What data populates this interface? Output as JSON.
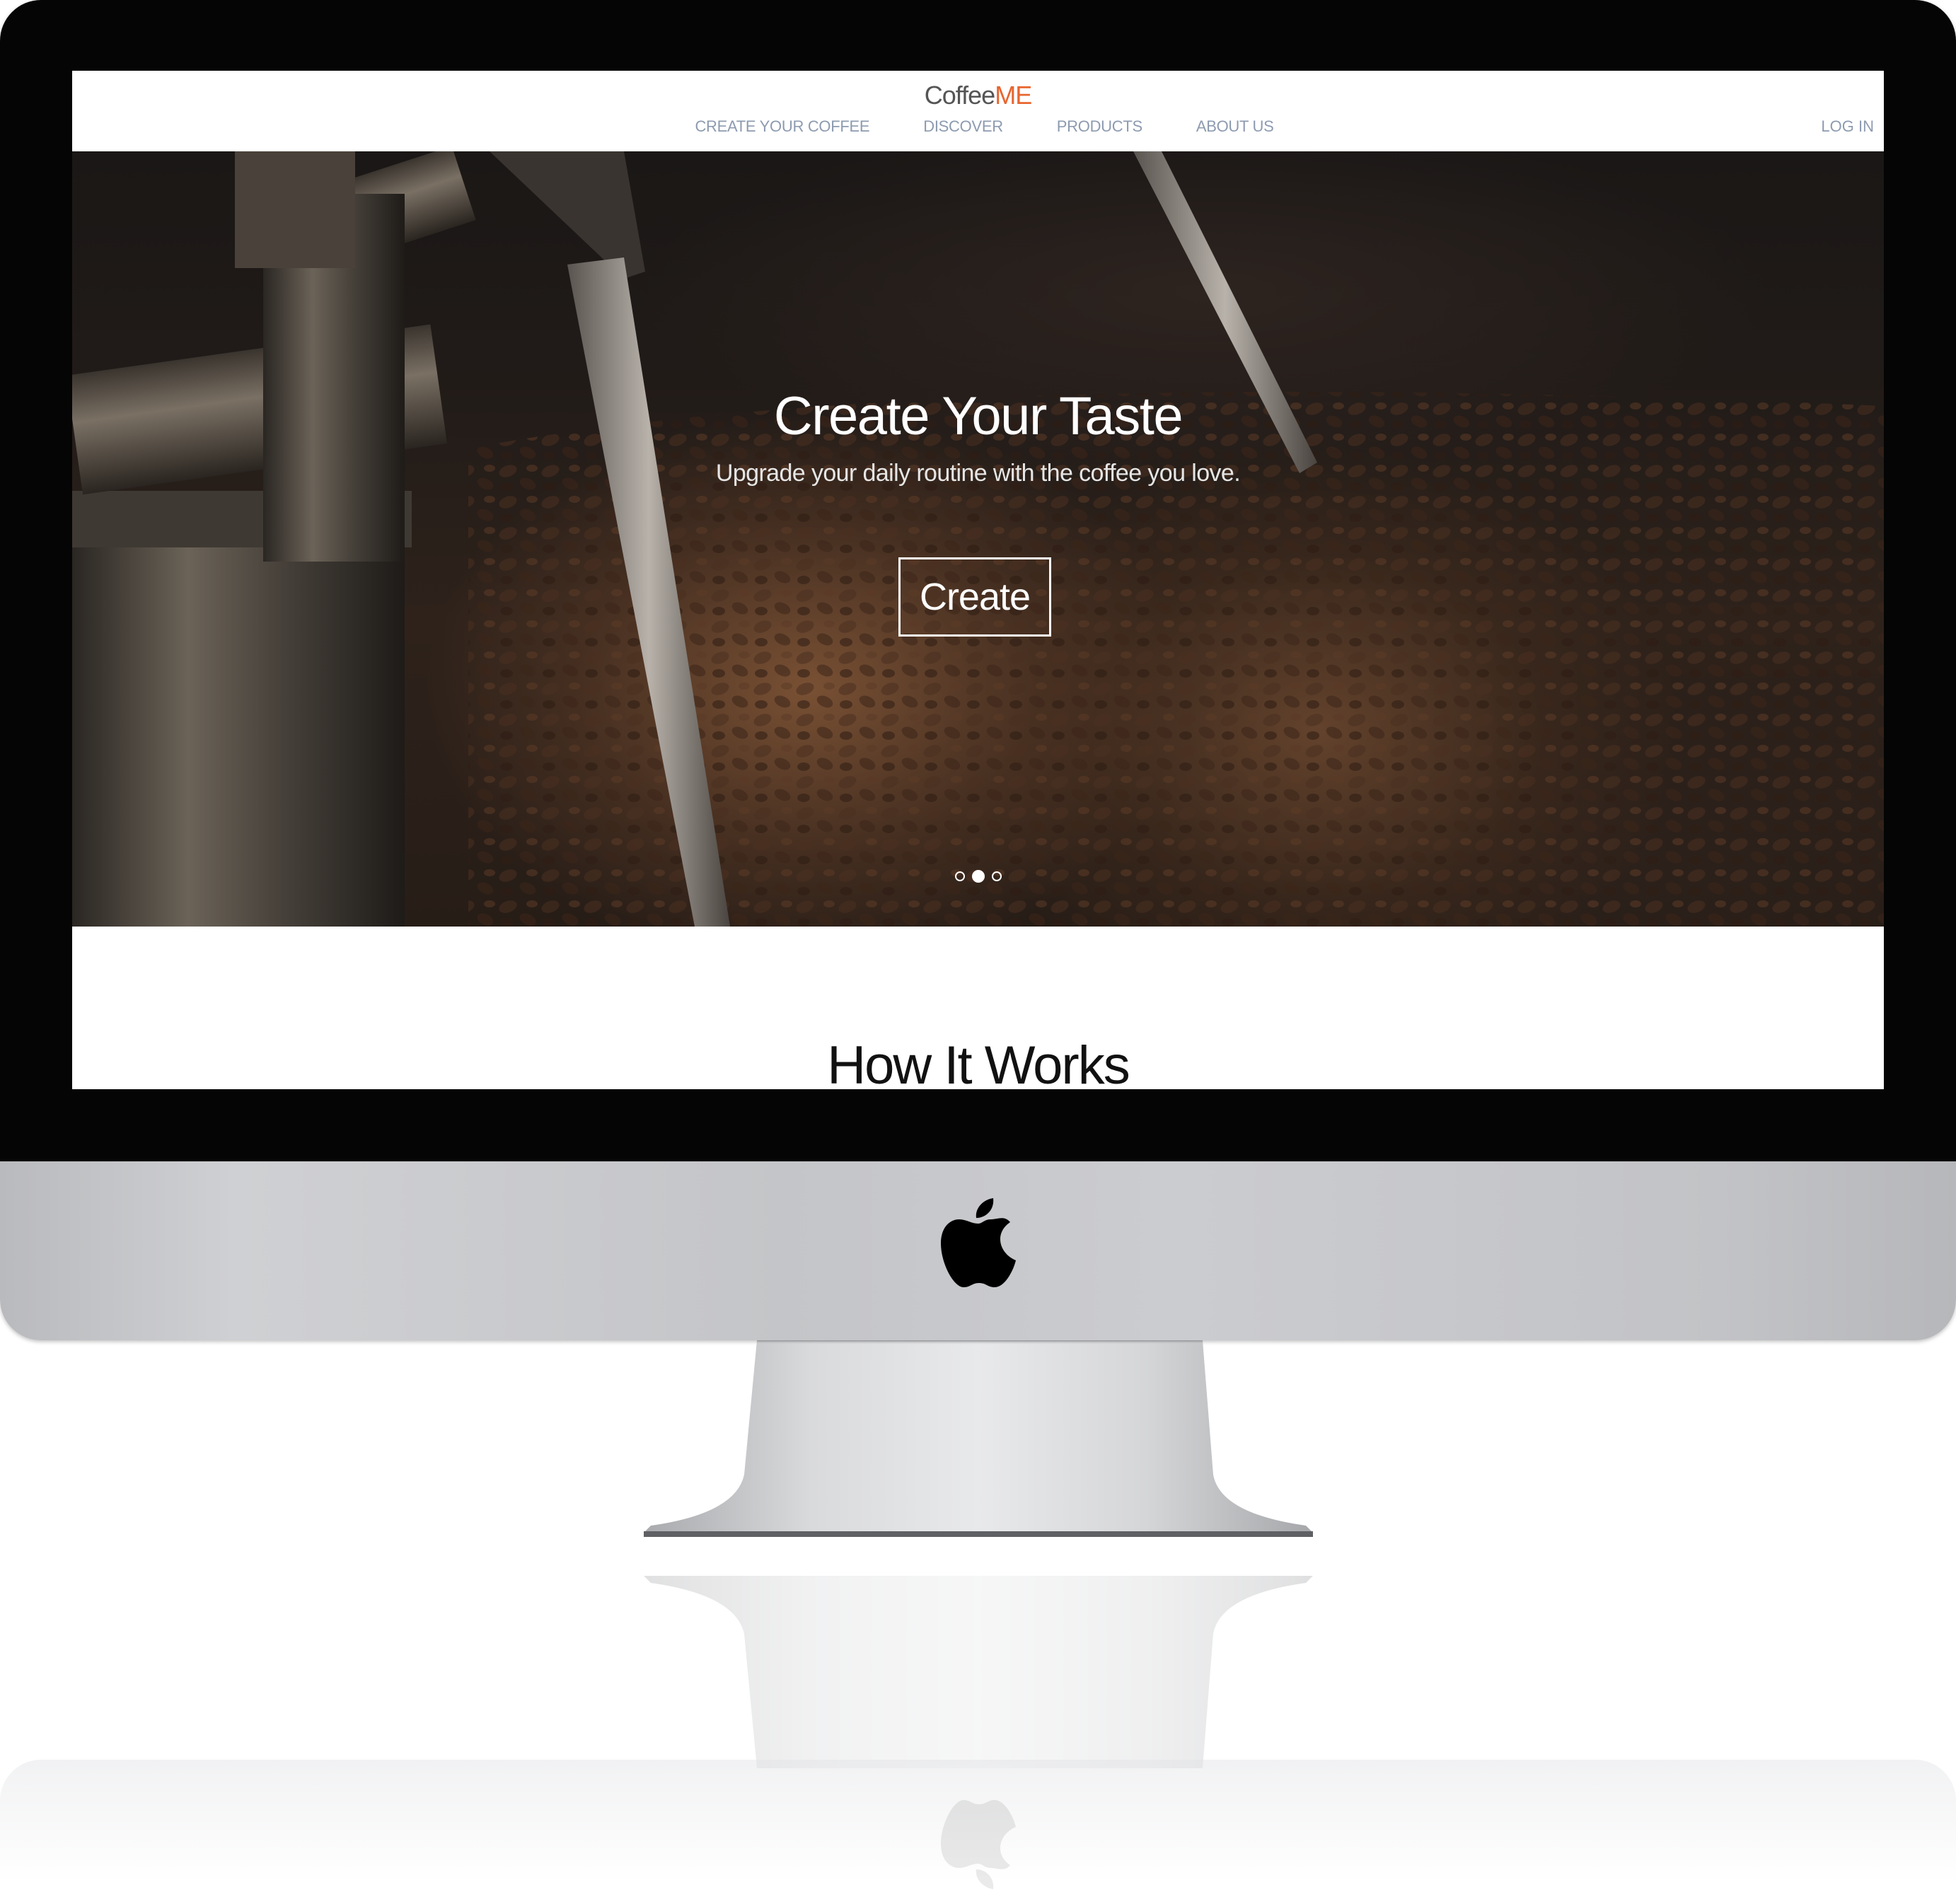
{
  "brand": {
    "name_part1": "Coffee",
    "name_part2": "ME",
    "accent_color": "#e8652f"
  },
  "nav": {
    "links": [
      {
        "label": "CREATE YOUR COFFEE"
      },
      {
        "label": "DISCOVER"
      },
      {
        "label": "PRODUCTS"
      },
      {
        "label": "ABOUT US"
      }
    ],
    "login_label": "LOG IN",
    "link_color": "#8d9bb0"
  },
  "hero": {
    "title": "Create Your Taste",
    "subtitle": "Upgrade your daily routine with the coffee you love.",
    "button_label": "Create",
    "carousel": {
      "slide_count": 3,
      "active_slide": 2
    }
  },
  "section": {
    "title": "How It Works"
  },
  "device": {
    "logo_icon": "apple-logo-icon"
  }
}
